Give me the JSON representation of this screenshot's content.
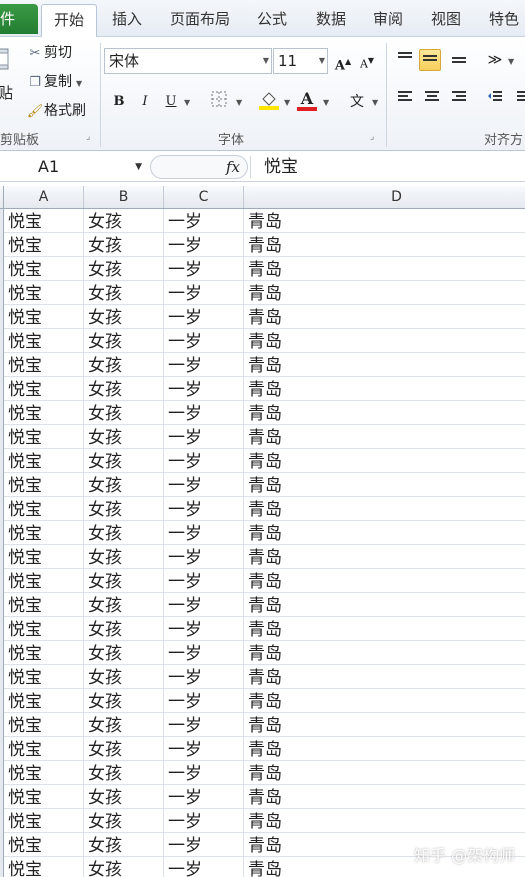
{
  "tabs": {
    "file": "件",
    "home": "开始",
    "insert": "插入",
    "page_layout": "页面布局",
    "formulas": "公式",
    "data": "数据",
    "review": "审阅",
    "view": "视图",
    "special": "特色功"
  },
  "ribbon": {
    "clipboard": {
      "paste": "贴",
      "cut": "剪切",
      "copy": "复制",
      "format_painter": "格式刷",
      "label": "剪贴板"
    },
    "font": {
      "name": "宋体",
      "size": "11",
      "bold": "B",
      "italic": "I",
      "underline": "U",
      "grow": "A",
      "shrink": "A",
      "font_color": "A",
      "phonetic": "文",
      "label": "字体"
    },
    "alignment": {
      "label": "对齐方"
    }
  },
  "formula_bar": {
    "cell_ref": "A1",
    "fx": "fx",
    "value": "悦宝"
  },
  "columns": [
    "A",
    "B",
    "C",
    "D"
  ],
  "rows": [
    [
      "悦宝",
      "女孩",
      "一岁",
      "青岛"
    ],
    [
      "悦宝",
      "女孩",
      "一岁",
      "青岛"
    ],
    [
      "悦宝",
      "女孩",
      "一岁",
      "青岛"
    ],
    [
      "悦宝",
      "女孩",
      "一岁",
      "青岛"
    ],
    [
      "悦宝",
      "女孩",
      "一岁",
      "青岛"
    ],
    [
      "悦宝",
      "女孩",
      "一岁",
      "青岛"
    ],
    [
      "悦宝",
      "女孩",
      "一岁",
      "青岛"
    ],
    [
      "悦宝",
      "女孩",
      "一岁",
      "青岛"
    ],
    [
      "悦宝",
      "女孩",
      "一岁",
      "青岛"
    ],
    [
      "悦宝",
      "女孩",
      "一岁",
      "青岛"
    ],
    [
      "悦宝",
      "女孩",
      "一岁",
      "青岛"
    ],
    [
      "悦宝",
      "女孩",
      "一岁",
      "青岛"
    ],
    [
      "悦宝",
      "女孩",
      "一岁",
      "青岛"
    ],
    [
      "悦宝",
      "女孩",
      "一岁",
      "青岛"
    ],
    [
      "悦宝",
      "女孩",
      "一岁",
      "青岛"
    ],
    [
      "悦宝",
      "女孩",
      "一岁",
      "青岛"
    ],
    [
      "悦宝",
      "女孩",
      "一岁",
      "青岛"
    ],
    [
      "悦宝",
      "女孩",
      "一岁",
      "青岛"
    ],
    [
      "悦宝",
      "女孩",
      "一岁",
      "青岛"
    ],
    [
      "悦宝",
      "女孩",
      "一岁",
      "青岛"
    ],
    [
      "悦宝",
      "女孩",
      "一岁",
      "青岛"
    ],
    [
      "悦宝",
      "女孩",
      "一岁",
      "青岛"
    ],
    [
      "悦宝",
      "女孩",
      "一岁",
      "青岛"
    ],
    [
      "悦宝",
      "女孩",
      "一岁",
      "青岛"
    ],
    [
      "悦宝",
      "女孩",
      "一岁",
      "青岛"
    ],
    [
      "悦宝",
      "女孩",
      "一岁",
      "青岛"
    ],
    [
      "悦宝",
      "女孩",
      "一岁",
      "青岛"
    ],
    [
      "悦宝",
      "女孩",
      "一岁",
      "青岛"
    ]
  ],
  "watermark": "知乎 @架构师",
  "colors": {
    "file_tab": "#2e8b3a",
    "selected_button": "#f7cf5a",
    "font_color_bar": "#e02020",
    "highlight_bar": "#ffe600"
  }
}
